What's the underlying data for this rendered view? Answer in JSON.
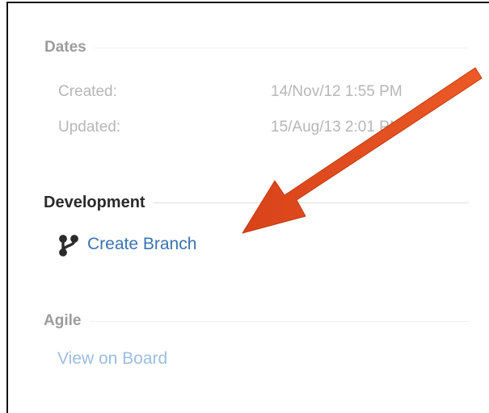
{
  "dates": {
    "heading": "Dates",
    "created_label": "Created:",
    "created_value": "14/Nov/12 1:55 PM",
    "updated_label": "Updated:",
    "updated_value": "15/Aug/13 2:01 PM"
  },
  "development": {
    "heading": "Development",
    "create_branch_label": "Create Branch",
    "branch_icon": "branch-icon"
  },
  "agile": {
    "heading": "Agile",
    "view_on_board_label": "View on Board"
  },
  "annotation": {
    "arrow_color": "#e04a1c"
  },
  "colors": {
    "link": "#3b73af",
    "link_faded": "#9dbde0",
    "muted_text": "#b7b7b7"
  }
}
